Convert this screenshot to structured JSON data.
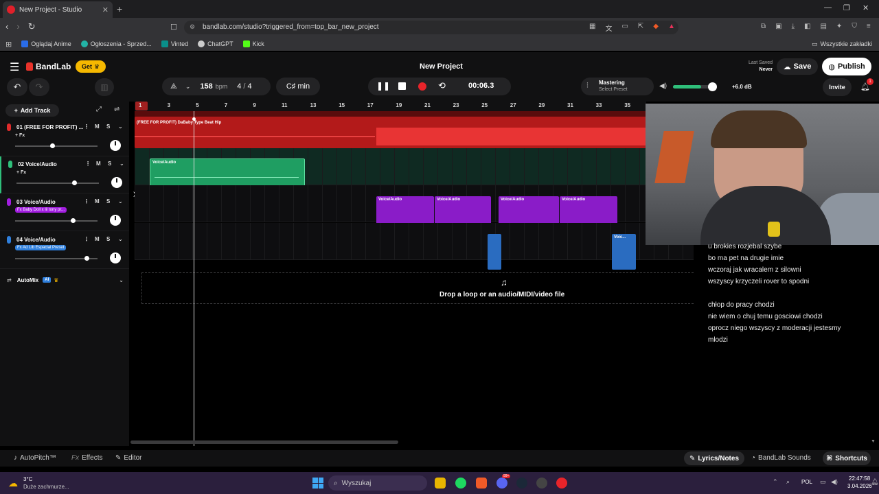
{
  "browser": {
    "tab_title": "New Project - Studio",
    "new_tab": "+",
    "url": "bandlab.com/studio?triggered_from=top_bar_new_project",
    "bookmarks": [
      {
        "label": "Oglądaj Anime",
        "color": "#2a6ce8"
      },
      {
        "label": "Ogłoszenia - Sprzed...",
        "color": "#23b3a6"
      },
      {
        "label": "Vinted",
        "color": "#0a8f8a"
      },
      {
        "label": "ChatGPT",
        "color": "#cccccc"
      },
      {
        "label": "Kick",
        "color": "#53fc18"
      }
    ],
    "all_bookmarks": "Wszystkie zakładki"
  },
  "app": {
    "brand": "BandLab",
    "get_label": "Get",
    "project_title": "New Project",
    "last_saved_label": "Last Saved",
    "last_saved_value": "Never",
    "save_label": "Save",
    "publish_label": "Publish",
    "invite_label": "Invite",
    "notification_count": "1"
  },
  "toolbar": {
    "bpm_value": "158",
    "bpm_unit": "bpm",
    "time_sig_num": "4",
    "time_sig_sep": "/",
    "time_sig_den": "4",
    "key": "C♯ min",
    "time": "00:06.3",
    "mastering_label": "Mastering",
    "select_preset": "Select Preset",
    "db_value": "+6.0 dB",
    "volume_level": 0.7
  },
  "tracks_panel": {
    "add_track": "Add Track",
    "tracks": [
      {
        "name": "01  (FREE FOR PROFIT) ...",
        "fx": "+ Fx",
        "color": "#e02b2b",
        "m": "M",
        "s": "S"
      },
      {
        "name": "02  Voice/Audio",
        "fx": "+ Fx",
        "color": "#2fbf7a",
        "m": "M",
        "s": "S"
      },
      {
        "name": "03  Voice/Audio",
        "badge": "Fx  Baby Doll x lil tony pr...",
        "color": "#a21ee0",
        "m": "M",
        "s": "S"
      },
      {
        "name": "04  Voice/Audio",
        "badge": "Fx  Ad Lib Espacial Preset",
        "color": "#2f7fdc",
        "m": "M",
        "s": "S"
      }
    ],
    "automix": "AutoMix",
    "ai_badge": "AI"
  },
  "ruler": {
    "ticks": [
      "1",
      "3",
      "5",
      "7",
      "9",
      "11",
      "13",
      "15",
      "17",
      "19",
      "21",
      "23",
      "25",
      "27",
      "29",
      "31",
      "33",
      "35"
    ]
  },
  "clips": {
    "track1_label": "(FREE FOR PROFIT) DaBaby Type Beat  Hip",
    "voice_label": "Voice/Audio",
    "voice_short": "Voic..."
  },
  "dropzone": {
    "text": "Drop a loop or an audio/MIDI/video file"
  },
  "lyrics": {
    "lines": [
      "u brokies rozjebal szybe",
      "bo ma pet na drugie imie",
      "wczoraj jak wracalem z silowni",
      "wszyscy krzyczeli rover to spodni",
      "",
      "chłop do pracy chodzi",
      "nie wiem o chuj temu gosciowi chodzi",
      "oprocz niego wszyscy z moderacji jestesmy",
      "mlodzi"
    ]
  },
  "bottombar": {
    "autopitch": "AutoPitch™",
    "effects": "Effects",
    "editor": "Editor",
    "lyrics_notes": "Lyrics/Notes",
    "bandlab_sounds": "BandLab Sounds",
    "shortcuts": "Shortcuts"
  },
  "taskbar": {
    "temp": "3°C",
    "weather": "Duże zachmurze...",
    "search": "Wyszukaj",
    "lang": "POL",
    "time": "22:47:58",
    "date": "3.04.2026",
    "badge_count": "99+"
  }
}
